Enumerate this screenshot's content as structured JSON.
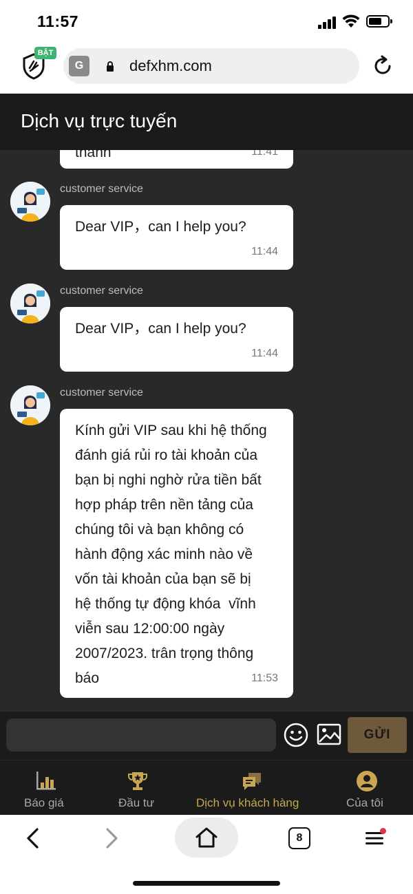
{
  "status": {
    "time": "11:57"
  },
  "browser": {
    "shield_badge": "BẬT",
    "translate_glyph": "G",
    "url": "defxhm.com"
  },
  "app": {
    "title": "Dịch vụ trực tuyến"
  },
  "chat": {
    "partial": {
      "text": "thành",
      "time": "11:41"
    },
    "messages": [
      {
        "sender": "customer service",
        "text": "Dear VIP，can I help you?",
        "time": "11:44"
      },
      {
        "sender": "customer service",
        "text": "Dear VIP，can I help you?",
        "time": "11:44"
      },
      {
        "sender": "customer service",
        "lines": [
          "Kính gửi VIP sau khi hệ thống",
          "đánh giá rủi ro tài khoản của",
          "bạn bị nghi nghờ rửa tiền bất",
          "hợp pháp trên nền tảng của",
          "chúng tôi và bạn không có",
          "hành động xác minh nào về",
          "vốn tài khoản của bạn sẽ bị",
          "hệ thống tự động khóa  vĩnh",
          "viễn sau 12:00:00 ngày",
          "2007/2023. trân trọng thông",
          "báo"
        ],
        "time": "11:53"
      }
    ]
  },
  "input": {
    "value": "",
    "send_label": "GỬI"
  },
  "nav": {
    "items": [
      {
        "label": "Báo giá",
        "icon": "bar-chart-icon",
        "active": false
      },
      {
        "label": "Đầu tư",
        "icon": "trophy-icon",
        "active": false
      },
      {
        "label": "Dịch vụ khách hàng",
        "icon": "chat-bubbles-icon",
        "active": true
      },
      {
        "label": "Của tôi",
        "icon": "user-icon",
        "active": false
      }
    ]
  },
  "toolbar": {
    "tab_count": "8"
  },
  "colors": {
    "accent": "#caa552",
    "send_button": "#6e5a3a",
    "chat_background": "#292929",
    "header_background": "#1a1a1a"
  }
}
